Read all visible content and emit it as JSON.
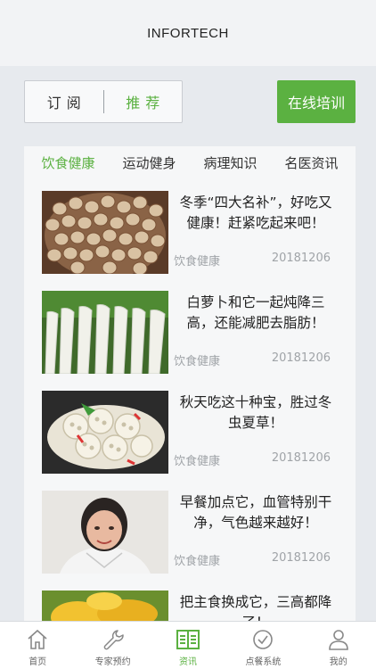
{
  "header": {
    "title": "INFORTECH"
  },
  "segmented": {
    "subscribe": "订阅",
    "recommend": "推荐"
  },
  "training_button": "在线培训",
  "category_tabs": [
    "饮食健康",
    "运动健身",
    "病理知识",
    "名医资讯"
  ],
  "news": [
    {
      "title": "冬季“四大名补”，好吃又健康！赶紧吃起来吧！",
      "tag": "饮食健康",
      "date": "20181206"
    },
    {
      "title": "白萝卜和它一起炖降三高，还能减肥去脂肪！",
      "tag": "饮食健康",
      "date": "20181206"
    },
    {
      "title": "秋天吃这十种宝，胜过冬虫夏草！",
      "tag": "饮食健康",
      "date": "20181206"
    },
    {
      "title": "早餐加点它，血管特别干净，气色越来越好！",
      "tag": "饮食健康",
      "date": "20181206"
    },
    {
      "title": "把主食换成它，三高都降了！",
      "tag": "",
      "date": ""
    }
  ],
  "bottom_nav": [
    {
      "label": "首页",
      "icon": "home-icon"
    },
    {
      "label": "专家预约",
      "icon": "wrench-icon"
    },
    {
      "label": "资讯",
      "icon": "news-icon"
    },
    {
      "label": "点餐系统",
      "icon": "check-circle-icon"
    },
    {
      "label": "我的",
      "icon": "person-icon"
    }
  ],
  "colors": {
    "accent": "#5bb141",
    "background": "#e7eaee",
    "muted": "#a0a4a8"
  }
}
